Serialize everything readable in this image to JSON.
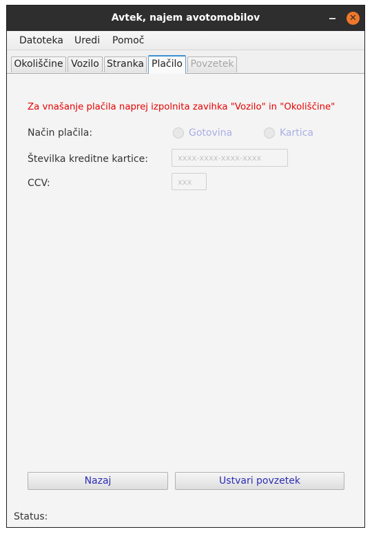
{
  "window": {
    "title": "Avtek, najem avotomobilov"
  },
  "menubar": {
    "items": [
      "Datoteka",
      "Uredi",
      "Pomoč"
    ]
  },
  "tabs": [
    "Okoliščine",
    "Vozilo",
    "Stranka",
    "Plačilo",
    "Povzetek"
  ],
  "payment": {
    "warning": "Za vnašanje plačila naprej izpolnita zavihka \"Vozilo\" in \"Okoliščine\"",
    "method_label": "Način plačila:",
    "options": [
      "Gotovina",
      "Kartica"
    ],
    "card_label": "Številka kreditne kartice:",
    "card_placeholder": "xxxx-xxxx-xxxx-xxxx",
    "ccv_label": "CCV:",
    "ccv_placeholder": "xxx"
  },
  "buttons": {
    "back": "Nazaj",
    "summary": "Ustvari povzetek"
  },
  "status": {
    "label": "Status:"
  },
  "colors": {
    "warning": "#e60000",
    "active_tab": "#3b8fd0",
    "button_text": "#2b2bb5",
    "close": "#f0772a"
  }
}
